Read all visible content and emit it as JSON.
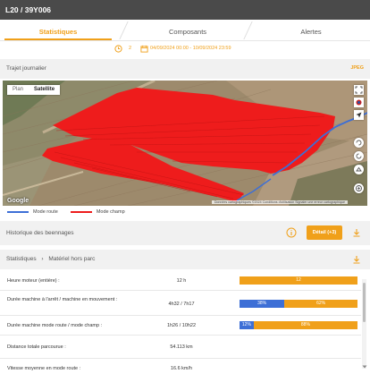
{
  "header": {
    "title": "L20 / 39Y006"
  },
  "tabs": [
    {
      "label": "Statistiques",
      "active": true
    },
    {
      "label": "Composants",
      "active": false
    },
    {
      "label": "Alertes",
      "active": false
    }
  ],
  "datebar": {
    "number": "2",
    "range": "04/09/2024 00:00 - 10/09/2024 23:59"
  },
  "trajet": {
    "title": "Trajet journalier",
    "action": "JPEG"
  },
  "map": {
    "type_options": [
      "Plan",
      "Satellite"
    ],
    "selected": "Satellite",
    "google_label": "Google",
    "attribution": "Données cartographiques ©2024   Conditions d'utilisation   Signaler une erreur cartographique"
  },
  "legend": [
    {
      "label": "Mode route",
      "color": "#3d6fd6"
    },
    {
      "label": "Mode champ",
      "color": "#ee1c1c"
    }
  ],
  "historique": {
    "title": "Historique des beennages",
    "button": "Détail (+3)"
  },
  "statistiques": {
    "title": "Statistiques",
    "separator": "›",
    "subtitle": "Matériel hors parc"
  },
  "colors": {
    "accent": "#f0a01a",
    "route": "#3d6fd6",
    "champ": "#ee1c1c",
    "blue_bar": "#3d6fd6"
  },
  "rows": [
    {
      "label": "Heure moteur (entière) :",
      "value": "12 h",
      "bar": [
        {
          "label": "12",
          "fraction": 1.0,
          "color": "#f0a01a"
        }
      ]
    },
    {
      "label": "Durée machine à l'arrêt / machine en mouvement :",
      "value": "4h32 / 7h17",
      "bar": [
        {
          "label": "38%",
          "fraction": 0.38,
          "color": "#3d6fd6"
        },
        {
          "label": "62%",
          "fraction": 0.62,
          "color": "#f0a01a"
        }
      ]
    },
    {
      "label": "Durée machine mode route / mode champ :",
      "value": "1h26 / 10h22",
      "bar": [
        {
          "label": "12%",
          "fraction": 0.12,
          "color": "#3d6fd6"
        },
        {
          "label": "88%",
          "fraction": 0.88,
          "color": "#f0a01a"
        }
      ]
    },
    {
      "label": "Distance totale parcourue :",
      "value": "54.113 km",
      "bar": []
    },
    {
      "label": "Vitesse moyenne en mode route :",
      "value": "16.6 km/h",
      "bar": []
    }
  ]
}
